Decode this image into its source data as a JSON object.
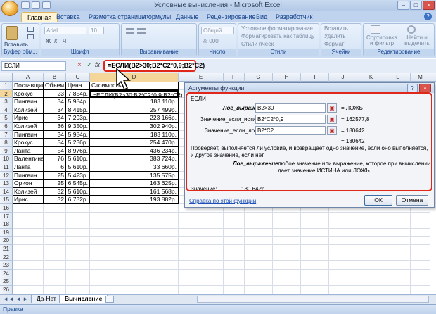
{
  "window": {
    "title": "Условные вычисления - Microsoft Excel"
  },
  "tabs": [
    "Главная",
    "Вставка",
    "Разметка страницы",
    "Формулы",
    "Данные",
    "Рецензирование",
    "Вид",
    "Разработчик"
  ],
  "ribbon": {
    "paste": "Вставить",
    "clipboard_label": "Буфер обм...",
    "font_name": "Arial",
    "font_size": "10",
    "font_label": "Шрифт",
    "align_label": "Выравнивание",
    "number_format": "Общий",
    "number_label": "Число",
    "conditional_format": "Условное форматирование",
    "format_as_table": "Форматировать как таблицу",
    "cell_styles": "Стили ячеек",
    "styles_label": "Стили",
    "insert": "Вставить",
    "delete": "Удалить",
    "format": "Формат",
    "cells_label": "Ячейки",
    "sort": "Сортировка и фильтр",
    "find": "Найти и выделить",
    "editing_label": "Редактирование"
  },
  "formula_bar": {
    "name_box": "ЕСЛИ",
    "formula": "=ЕСЛИ(B2>30;B2*C2*0,9;B2*C2)"
  },
  "columns": [
    "A",
    "B",
    "C",
    "D",
    "E",
    "F",
    "G",
    "H",
    "I",
    "J",
    "K",
    "L",
    "M"
  ],
  "rows": [
    [
      "Поставщик",
      "Объем",
      "Цена",
      "Стоимость"
    ],
    [
      "Крокус",
      "23",
      "7 854р.",
      "=ЕСЛИ(B2>30;B2*C2*0,9;B2*C2)"
    ],
    [
      "Пингвин",
      "34",
      "5 984р.",
      "183 110р."
    ],
    [
      "Колизей",
      "34",
      "8 415р.",
      "257 499р."
    ],
    [
      "Ирис",
      "34",
      "7 293р.",
      "223 166р."
    ],
    [
      "Колизей",
      "36",
      "9 350р.",
      "302 940р."
    ],
    [
      "Пингвин",
      "34",
      "5 984р.",
      "183 110р."
    ],
    [
      "Крокус",
      "54",
      "5 236р.",
      "254 470р."
    ],
    [
      "Ланта",
      "54",
      "8 976р.",
      "436 234р."
    ],
    [
      "Валентина",
      "76",
      "5 610р.",
      "383 724р."
    ],
    [
      "Ланта",
      "6",
      "5 610р.",
      "33 660р."
    ],
    [
      "Пингвин",
      "25",
      "5 423р.",
      "135 575р."
    ],
    [
      "Орион",
      "25",
      "6 545р.",
      "163 625р."
    ],
    [
      "Колизей",
      "32",
      "5 610р.",
      "161 568р."
    ],
    [
      "Ирис",
      "32",
      "6 732р.",
      "193 882р."
    ]
  ],
  "row_numbers": [
    "1",
    "2",
    "3",
    "4",
    "5",
    "6",
    "7",
    "8",
    "9",
    "10",
    "11",
    "12",
    "13",
    "14",
    "15",
    "16",
    "17",
    "18",
    "19",
    "20",
    "21",
    "22",
    "23",
    "24",
    "25",
    "26"
  ],
  "dialog": {
    "title": "Аргументы функции",
    "func": "ЕСЛИ",
    "arg1_label": "Лог_выражение",
    "arg1_value": "B2>30",
    "arg1_result": "= ЛОЖЬ",
    "arg2_label": "Значение_если_истина",
    "arg2_value": "B2*C2*0,9",
    "arg2_result": "= 162577,8",
    "arg3_label": "Значение_если_ложь",
    "arg3_value": "B2*C2",
    "arg3_result": "= 180642",
    "total_result": "= 180642",
    "description": "Проверяет, выполняется ли условие, и возвращает одно значение, если оно выполняется, и другое значение, если нет.",
    "arg_help_name": "Лог_выражение",
    "arg_help_text": "любое значение или выражение, которое при вычислении дает значение ИСТИНА или ЛОЖЬ.",
    "value_label": "Значение:",
    "value": "180 642р.",
    "help_link": "Справка по этой функции",
    "ok": "ОК",
    "cancel": "Отмена"
  },
  "sheets": [
    "Да-Нет",
    "Вычисление"
  ],
  "status": "Правка"
}
